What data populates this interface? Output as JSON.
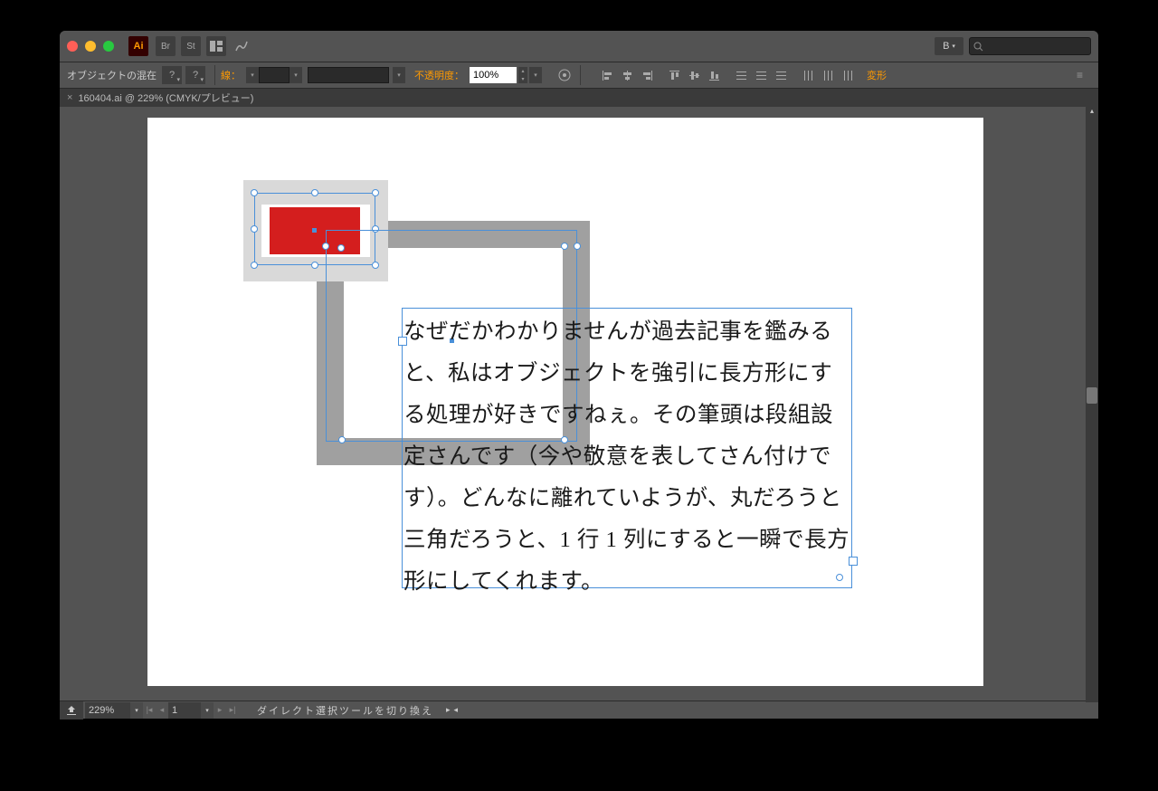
{
  "app": {
    "name": "Ai"
  },
  "titlebar": {
    "char_btn": "B",
    "search_placeholder": ""
  },
  "controlbar": {
    "mix_label": "オブジェクトの混在",
    "stroke_label": "線：",
    "stroke_value": "",
    "opacity_label": "不透明度：",
    "opacity_value": "100%",
    "transform_label": "変形"
  },
  "tab": {
    "filename": "160404.ai @ 229% (CMYK/プレビュー)"
  },
  "canvas": {
    "text_content": "なぜだかわかりませんが過去記事を鑑みると、私はオブジェクトを強引に長方形にする処理が好きですねぇ。その筆頭は段組設定さんです（今や敬意を表してさん付けです）。どんなに離れていようが、丸だろうと三角だろうと、1 行 1 列にすると一瞬で長方形にしてくれます。"
  },
  "statusbar": {
    "zoom": "229%",
    "artboard": "1",
    "tool_status": "ダイレクト選択ツールを切り換え"
  }
}
